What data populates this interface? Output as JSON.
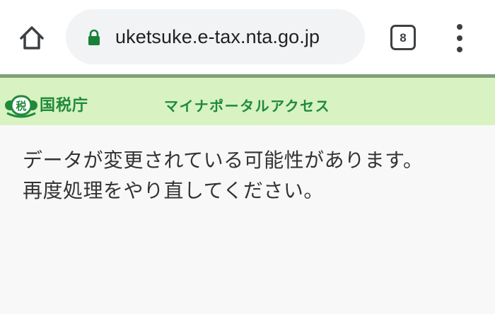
{
  "browser": {
    "url": "uketsuke.e-tax.nta.go.jp",
    "tab_count": "8",
    "icons": {
      "home": "home-icon",
      "lock": "lock-icon",
      "tabs": "tab-switcher-icon",
      "menu": "more-vert-icon"
    },
    "colors": {
      "lock": "#188038",
      "chrome_bg": "#ffffff",
      "omnibox_bg": "#f1f3f4"
    }
  },
  "site_header": {
    "logo_mark_text": "税",
    "logo_text": "国税庁",
    "portal_link": "マイナポータルアクセス",
    "colors": {
      "background": "#d8f2c2",
      "brand": "#1f8a3a"
    }
  },
  "message": {
    "line1": "データが変更されている可能性があります。",
    "line2": "再度処理をやり直してください。"
  }
}
